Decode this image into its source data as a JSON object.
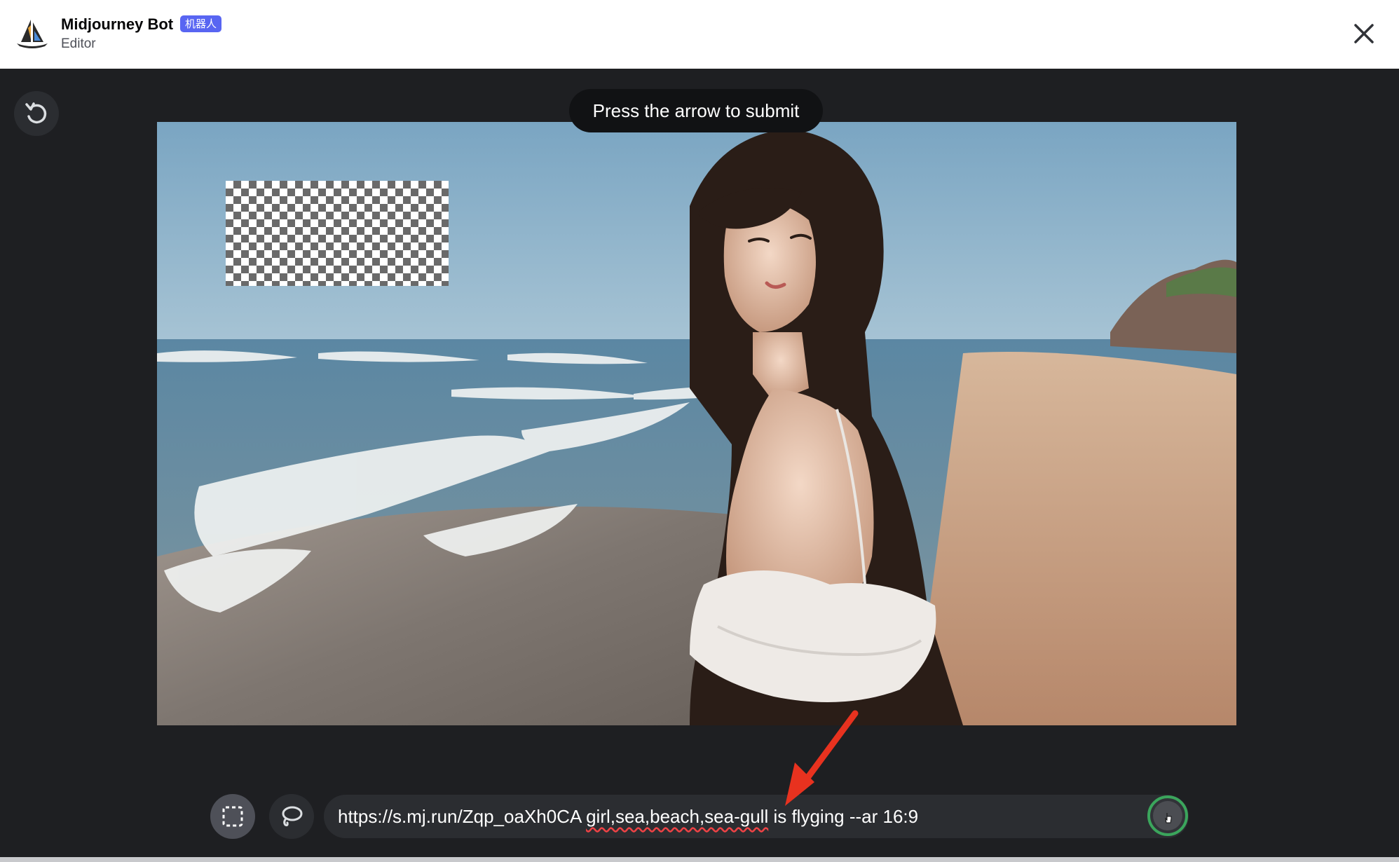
{
  "header": {
    "bot_name": "Midjourney Bot",
    "badge": "机器人",
    "subtitle": "Editor",
    "close_icon": "close-icon",
    "avatar_icon": "sailboat-icon"
  },
  "editor": {
    "hint": "Press the arrow to submit",
    "reset_icon": "reset-icon",
    "image_description_icon": "image",
    "tools": [
      {
        "name": "rectangle-select",
        "icon": "dashed-square-icon",
        "active": true
      },
      {
        "name": "lasso-select",
        "icon": "lasso-icon",
        "active": false
      }
    ],
    "prompt": {
      "part_url": "https://s.mj.run/Zqp_oaXh0CA ",
      "part_words": "girl,sea,beach,sea-gull",
      "part_rest": " is flyging --ar 16:9"
    },
    "submit_icon": "submit-arrow-icon"
  },
  "colors": {
    "editor_bg": "#1e1f22",
    "badge": "#5865f2",
    "submit_ring": "#3ba55c",
    "annotation_arrow": "#e8321f"
  }
}
